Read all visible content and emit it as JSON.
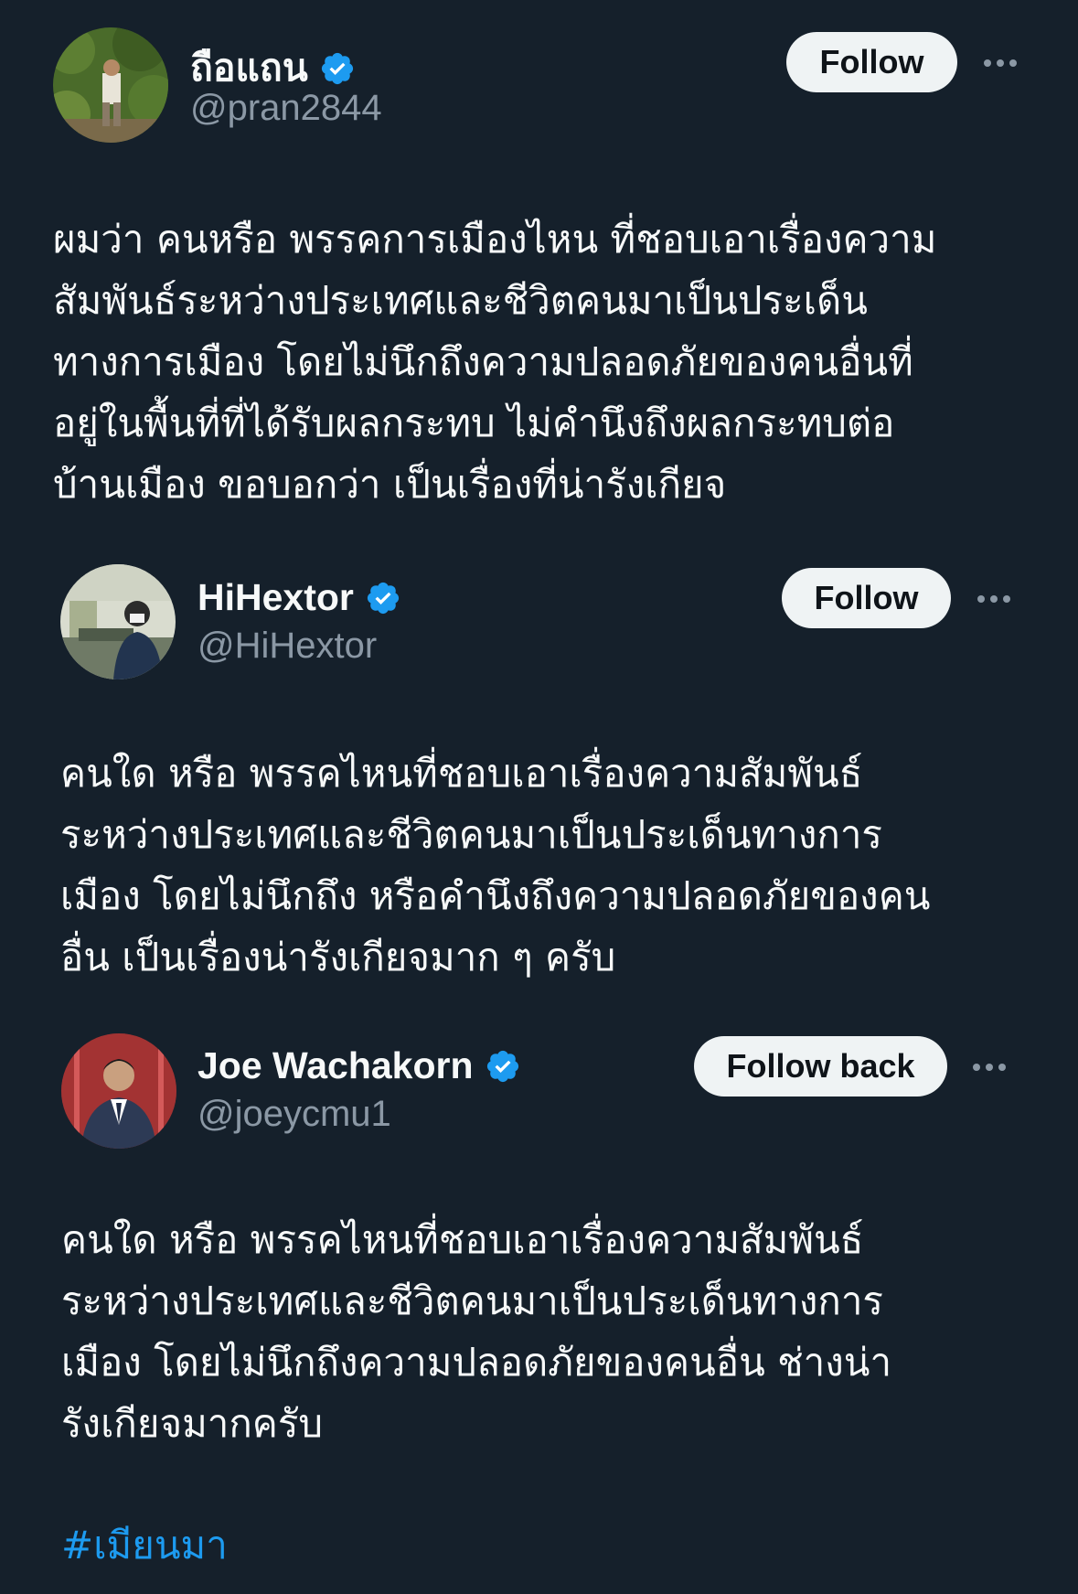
{
  "posts": [
    {
      "display_name": "ถือแถน",
      "handle": "@pran2844",
      "follow_label": "Follow",
      "verified": true,
      "text": "ผมว่า คนหรือ พรรคการเมืองไหน ที่ชอบเอาเรื่องความ\nสัมพันธ์ระหว่างประเทศและชีวิตคนมาเป็นประเด็น\nทางการเมือง โดยไม่นึกถึงความปลอดภัยของคนอื่นที่\nอยู่ในพื้นที่ที่ได้รับผลกระทบ ไม่คำนึงถึงผลกระทบต่อ\nบ้านเมือง ขอบอกว่า เป็นเรื่องที่น่ารังเกียจ"
    },
    {
      "display_name": "HiHextor",
      "handle": "@HiHextor",
      "follow_label": "Follow",
      "verified": true,
      "text": "คนใด หรือ พรรคไหนที่ชอบเอาเรื่องความสัมพันธ์\nระหว่างประเทศและชีวิตคนมาเป็นประเด็นทางการ\nเมือง โดยไม่นึกถึง หรือคำนึงถึงความปลอดภัยของคน\nอื่น เป็นเรื่องน่ารังเกียจมาก ๆ ครับ"
    },
    {
      "display_name": "Joe Wachakorn",
      "handle": "@joeycmu1",
      "follow_label": "Follow back",
      "verified": true,
      "text": "คนใด หรือ พรรคไหนที่ชอบเอาเรื่องความสัมพันธ์\nระหว่างประเทศและชีวิตคนมาเป็นประเด็นทางการ\nเมือง โดยไม่นึกถึงความปลอดภัยของคนอื่น ช่างน่า\nรังเกียจมากครับ",
      "hashtag": "#เมียนมา"
    }
  ],
  "colors": {
    "background": "#15202b",
    "text": "#f7f9f9",
    "secondary": "#8b98a5",
    "accent": "#1d9bf0",
    "button_bg": "#eff3f4"
  },
  "icons": {
    "verified": "verified-badge-icon",
    "more": "more-options-icon"
  }
}
